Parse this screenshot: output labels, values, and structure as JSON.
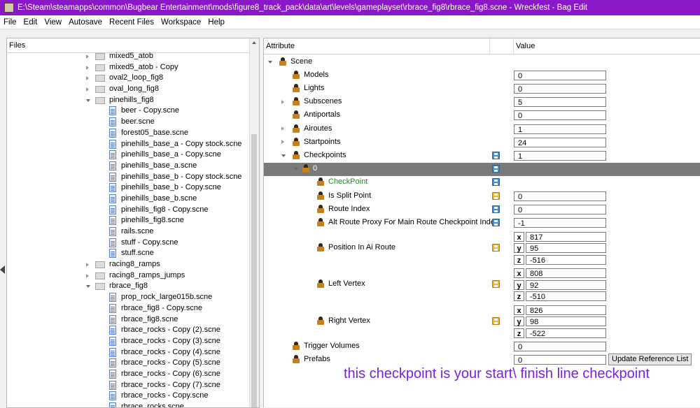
{
  "window": {
    "title": "E:\\Steam\\steamapps\\common\\Bugbear Entertainment\\mods\\figure8_track_pack\\data\\art\\levels\\gameplayset\\rbrace_fig8\\rbrace_fig8.scne - Wreckfest - Bag Edit"
  },
  "menu": [
    "File",
    "Edit",
    "View",
    "Autosave",
    "Recent Files",
    "Workspace",
    "Help"
  ],
  "files": {
    "header": "Files",
    "items": [
      {
        "label": "mixed5_atob",
        "type": "folder",
        "expander": "collapsed"
      },
      {
        "label": "mixed5_atob - Copy",
        "type": "folder",
        "expander": "collapsed"
      },
      {
        "label": "oval2_loop_fig8",
        "type": "folder",
        "expander": "collapsed"
      },
      {
        "label": "oval_long_fig8",
        "type": "folder",
        "expander": "collapsed"
      },
      {
        "label": "pinehills_fig8",
        "type": "folder",
        "expander": "expanded"
      },
      {
        "label": "beer - Copy.scne",
        "type": "file"
      },
      {
        "label": "beer.scne",
        "type": "file"
      },
      {
        "label": "forest05_base.scne",
        "type": "file"
      },
      {
        "label": "pinehills_base_a - Copy stock.scne",
        "type": "file"
      },
      {
        "label": "pinehills_base_a - Copy.scne",
        "type": "file"
      },
      {
        "label": "pinehills_base_a.scne",
        "type": "file"
      },
      {
        "label": "pinehills_base_b - Copy stock.scne",
        "type": "file"
      },
      {
        "label": "pinehills_base_b - Copy.scne",
        "type": "file"
      },
      {
        "label": "pinehills_base_b.scne",
        "type": "file"
      },
      {
        "label": "pinehills_fig8 - Copy.scne",
        "type": "file"
      },
      {
        "label": "pinehills_fig8.scne",
        "type": "file"
      },
      {
        "label": "rails.scne",
        "type": "file"
      },
      {
        "label": "stuff - Copy.scne",
        "type": "file"
      },
      {
        "label": "stuff.scne",
        "type": "file"
      },
      {
        "label": "racing8_ramps",
        "type": "folder",
        "expander": "collapsed"
      },
      {
        "label": "racing8_ramps_jumps",
        "type": "folder",
        "expander": "collapsed"
      },
      {
        "label": "rbrace_fig8",
        "type": "folder",
        "expander": "expanded"
      },
      {
        "label": "prop_rock_large015b.scne",
        "type": "file"
      },
      {
        "label": "rbrace_fig8 - Copy.scne",
        "type": "file"
      },
      {
        "label": "rbrace_fig8.scne",
        "type": "file"
      },
      {
        "label": "rbrace_rocks - Copy (2).scne",
        "type": "file"
      },
      {
        "label": "rbrace_rocks - Copy (3).scne",
        "type": "file"
      },
      {
        "label": "rbrace_rocks - Copy (4).scne",
        "type": "file"
      },
      {
        "label": "rbrace_rocks - Copy (5).scne",
        "type": "file"
      },
      {
        "label": "rbrace_rocks - Copy (6).scne",
        "type": "file"
      },
      {
        "label": "rbrace_rocks - Copy (7).scne",
        "type": "file"
      },
      {
        "label": "rbrace_rocks - Copy.scne",
        "type": "file"
      },
      {
        "label": "rbrace_rocks.scne",
        "type": "file"
      }
    ]
  },
  "attributes": {
    "header_attribute": "Attribute",
    "header_value": "Value",
    "rows": [
      {
        "label": "Scene",
        "level": 0,
        "expander": "expanded"
      },
      {
        "label": "Models",
        "level": 1,
        "value": "0"
      },
      {
        "label": "Lights",
        "level": 1,
        "value": "0"
      },
      {
        "label": "Subscenes",
        "level": 1,
        "expander": "collapsed",
        "value": "5"
      },
      {
        "label": "Antiportals",
        "level": 1,
        "value": "0"
      },
      {
        "label": "Airoutes",
        "level": 1,
        "expander": "collapsed",
        "value": "1"
      },
      {
        "label": "Startpoints",
        "level": 1,
        "expander": "collapsed",
        "value": "24"
      },
      {
        "label": "Checkpoints",
        "level": 1,
        "expander": "expanded",
        "save": "blue",
        "value": "1"
      },
      {
        "label": "0",
        "level": 2,
        "expander": "expanded",
        "save": "blue",
        "selected": true
      },
      {
        "label": "CheckPoint",
        "level": 3,
        "save": "blue",
        "green": true
      },
      {
        "label": "Is Split Point",
        "level": 3,
        "save": "orange",
        "value": "0"
      },
      {
        "label": "Route Index",
        "level": 3,
        "save": "blue",
        "value": "0"
      },
      {
        "label": "Alt Route Proxy For Main Route Checkpoint Index",
        "level": 3,
        "save": "blue",
        "value": "-1"
      },
      {
        "label": "Position In Ai Route",
        "level": 3,
        "save": "orange",
        "vector": [
          {
            "axis": "x",
            "value": "817"
          },
          {
            "axis": "y",
            "value": "95"
          },
          {
            "axis": "z",
            "value": "-516"
          }
        ]
      },
      {
        "label": "Left Vertex",
        "level": 3,
        "save": "orange",
        "vector": [
          {
            "axis": "x",
            "value": "808"
          },
          {
            "axis": "y",
            "value": "92"
          },
          {
            "axis": "z",
            "value": "-510"
          }
        ]
      },
      {
        "label": "Right Vertex",
        "level": 3,
        "save": "orange",
        "vector": [
          {
            "axis": "x",
            "value": "826"
          },
          {
            "axis": "y",
            "value": "98"
          },
          {
            "axis": "z",
            "value": "-522"
          }
        ]
      },
      {
        "label": "Trigger Volumes",
        "level": 1,
        "value": "0"
      },
      {
        "label": "Prefabs",
        "level": 1,
        "value": "0",
        "button": "Update Reference List"
      }
    ]
  },
  "annotation": "this checkpoint is your start\\ finish line checkpoint",
  "colors": {
    "titlebar": "#8a18c8",
    "annotation": "#7a22d8",
    "selected_row": "#7a7a7a",
    "green_label": "#1e8a1e"
  }
}
